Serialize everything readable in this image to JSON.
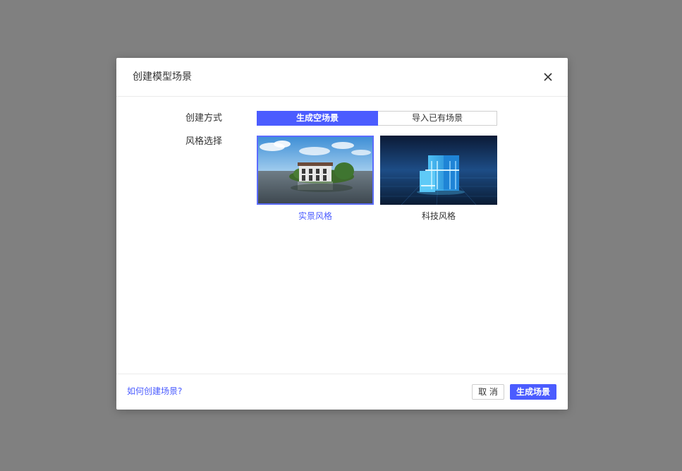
{
  "dialog": {
    "title": "创建模型场景"
  },
  "form": {
    "method_label": "创建方式",
    "style_label": "风格选择",
    "methods": [
      {
        "label": "生成空场景",
        "selected": true
      },
      {
        "label": "导入已有场景",
        "selected": false
      }
    ],
    "styles": [
      {
        "label": "实景风格",
        "selected": true,
        "thumbnail": "realistic-villa-image"
      },
      {
        "label": "科技风格",
        "selected": false,
        "thumbnail": "tech-buildings-image"
      }
    ]
  },
  "footer": {
    "help_link": "如何创建场景?",
    "cancel_label": "取 消",
    "confirm_label": "生成场景"
  },
  "colors": {
    "accent": "#4b5cff",
    "overlay": "#808080"
  },
  "icons": {
    "close": "close-icon"
  }
}
